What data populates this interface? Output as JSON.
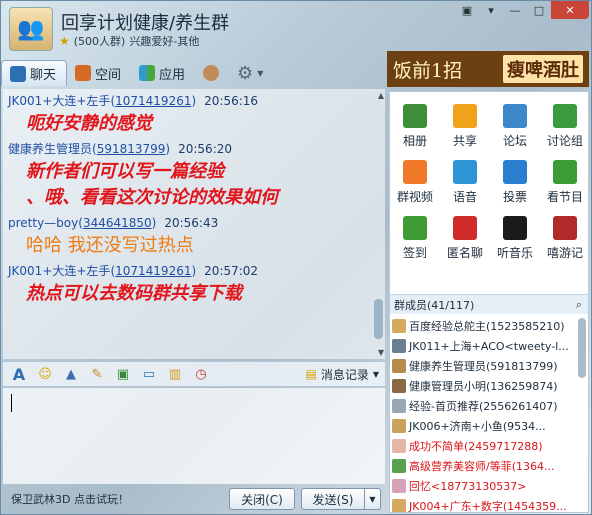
{
  "window": {
    "title": "回享计划健康/养生群",
    "member_count": "(500人群)",
    "subtitle": "兴趣爱好-其他",
    "controls": [
      "▣",
      "▾",
      "—",
      "□",
      "✕"
    ]
  },
  "tabs": [
    {
      "label": "聊天",
      "icon": "chat-icon",
      "active": true
    },
    {
      "label": "空间",
      "icon": "house-icon",
      "active": false
    },
    {
      "label": "应用",
      "icon": "apps-icon",
      "active": false
    }
  ],
  "ad": {
    "text1": "饭前1招",
    "text2": "瘦啤酒肚"
  },
  "messages": [
    {
      "sender": "JK001+大连+左手",
      "uid": "1071419261",
      "time": "20:56:16",
      "text": "呃好安静的感觉",
      "style": "red"
    },
    {
      "sender": "健康养生管理员",
      "uid": "591813799",
      "time": "20:56:20",
      "text": "新作者们可以写一篇经验",
      "text2": "、哦、看看这次讨论的效果如何",
      "style": "red"
    },
    {
      "sender": "pretty—boy",
      "uid": "344641850",
      "time": "20:56:43",
      "text": "哈哈  我还没写过热点",
      "style": "orange"
    },
    {
      "sender": "JK001+大连+左手",
      "uid": "1071419261",
      "time": "20:57:02",
      "text": "热点可以去数码群共享下载",
      "style": "red"
    }
  ],
  "toolbar": {
    "icons": [
      "font-icon",
      "emoji-icon",
      "shake-icon",
      "doodle-icon",
      "image-icon",
      "screen-icon",
      "chart-icon",
      "timer-icon"
    ],
    "history_label": "消息记录"
  },
  "bottom": {
    "promo": "保卫武林3D 点击试玩！",
    "close_label": "关闭(C)",
    "send_label": "发送(S)"
  },
  "apps": [
    {
      "label": "相册",
      "icon": "album-icon",
      "color": "#3f8f3a"
    },
    {
      "label": "共享",
      "icon": "folder-icon",
      "color": "#f0a21c"
    },
    {
      "label": "论坛",
      "icon": "forum-icon",
      "color": "#3c87c8"
    },
    {
      "label": "讨论组",
      "icon": "discussion-icon",
      "color": "#3a9a3e"
    },
    {
      "label": "群视频",
      "icon": "video-icon",
      "color": "#f07a2a"
    },
    {
      "label": "语音",
      "icon": "voice-icon",
      "color": "#2d95d6"
    },
    {
      "label": "投票",
      "icon": "vote-icon",
      "color": "#2a7fd0"
    },
    {
      "label": "看节目",
      "icon": "film-icon",
      "color": "#3c9c33"
    },
    {
      "label": "签到",
      "icon": "checkin-icon",
      "color": "#3e9b34"
    },
    {
      "label": "匿名聊",
      "icon": "mask-icon",
      "color": "#d22b2b"
    },
    {
      "label": "听音乐",
      "icon": "music-icon",
      "color": "#1b1b1b"
    },
    {
      "label": "嘻游记",
      "icon": "game-icon",
      "color": "#b02a2a"
    }
  ],
  "members_header": "群成员(41/117)",
  "members": [
    {
      "name": "百度经验总舵主(1523585210)",
      "red": false,
      "color": "#d7a85f"
    },
    {
      "name": "JK011+上海+ACO<tweety-l...",
      "red": false,
      "color": "#6a7f91"
    },
    {
      "name": "健康养生管理员(591813799)",
      "red": false,
      "color": "#b88a4c"
    },
    {
      "name": "健康管理员小明(136259874)",
      "red": false,
      "color": "#8a6a45"
    },
    {
      "name": "经验-首页推荐(2556261407)",
      "red": false,
      "color": "#9aa6b1"
    },
    {
      "name": "JK006+济南+小鱼(9534...",
      "red": false,
      "color": "#c9a35d"
    },
    {
      "name": "成功不简单(2459717288)",
      "red": true,
      "color": "#e3b7a3"
    },
    {
      "name": "高级营养美容师/等菲(1364...",
      "red": true,
      "color": "#59a14f"
    },
    {
      "name": "回忆<18773130537>",
      "red": true,
      "color": "#d8a2b8"
    },
    {
      "name": "JK004+广东+数字(1454359...",
      "red": true,
      "color": "#d7a85f"
    }
  ]
}
